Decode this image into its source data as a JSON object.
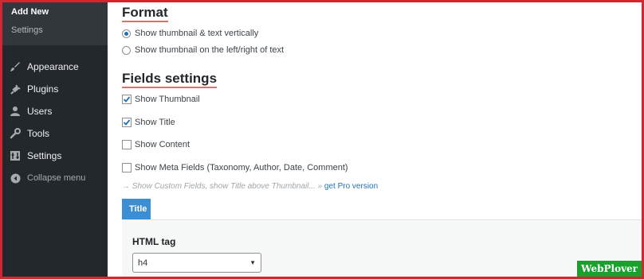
{
  "sidebar": {
    "submenu": [
      {
        "label": "Add New",
        "current": true
      },
      {
        "label": "Settings",
        "current": false
      }
    ],
    "items": [
      {
        "label": "Appearance",
        "icon": "paintbrush-icon"
      },
      {
        "label": "Plugins",
        "icon": "plugin-icon"
      },
      {
        "label": "Users",
        "icon": "user-icon"
      },
      {
        "label": "Tools",
        "icon": "wrench-icon"
      },
      {
        "label": "Settings",
        "icon": "settings-icon"
      }
    ],
    "collapse_label": "Collapse menu"
  },
  "format": {
    "heading": "Format",
    "options": [
      {
        "label": "Show thumbnail & text vertically",
        "selected": true
      },
      {
        "label": "Show thumbnail on the left/right of text",
        "selected": false
      }
    ]
  },
  "fields": {
    "heading": "Fields settings",
    "checkboxes": [
      {
        "label": "Show Thumbnail",
        "checked": true
      },
      {
        "label": "Show Title",
        "checked": true
      },
      {
        "label": "Show Content",
        "checked": false
      },
      {
        "label": "Show Meta Fields (Taxonomy, Author, Date, Comment)",
        "checked": false
      }
    ],
    "hint_text": "→ Show Custom Fields, show Title above Thumbnail... » ",
    "pro_link": "get Pro version"
  },
  "tabs": {
    "active": "Title"
  },
  "title_panel": {
    "html_tag_label": "HTML tag",
    "html_tag_value": "h4"
  },
  "watermark": "WebPlover",
  "colors": {
    "frame": "#d22630",
    "sidebar": "#23282d",
    "accent": "#2271b1",
    "tab": "#3b8ed4",
    "heading_underline": "#e36d6d",
    "badge": "#1aa02c"
  }
}
